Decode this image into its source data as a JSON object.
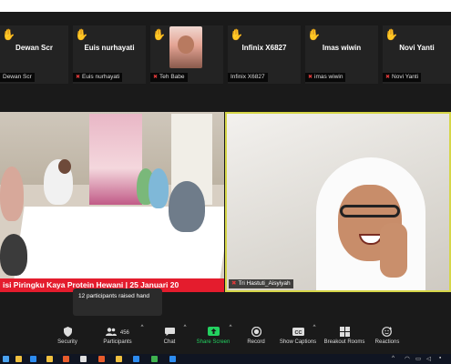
{
  "participants_strip": [
    {
      "name": "Dewan Scr",
      "label": "Dewan Scr",
      "muted": false
    },
    {
      "name": "Euis nurhayati",
      "label": "Euis nurhayati",
      "muted": true
    },
    {
      "name": "",
      "label": "Teh Babe",
      "muted": true,
      "has_video": true
    },
    {
      "name": "Infinix X6827",
      "label": "Infinix X6827",
      "muted": false
    },
    {
      "name": "Imas wiwin",
      "label": "imas wiwin",
      "muted": true
    },
    {
      "name": "Novi Yanti",
      "label": "Novi Yanti",
      "muted": true
    }
  ],
  "main_left": {
    "caption": "isi Piringku Kaya Protein Hewani | 25 Januari 20"
  },
  "main_right": {
    "name": "Tri Hastuti_Aisyiyah"
  },
  "tooltip": {
    "text": "12 participants raised hand"
  },
  "toolbar": {
    "security": "Security",
    "participants": "Participants",
    "participants_count": "456",
    "chat": "Chat",
    "share_screen": "Share Screen",
    "record": "Record",
    "show_captions": "Show Captions",
    "breakout_rooms": "Breakout Rooms",
    "reactions": "Reactions"
  },
  "colors": {
    "raised_hand": "#f5c518",
    "share_green": "#23d160",
    "caption_red": "#e41c2d",
    "active_speaker_border": "#d6d648"
  },
  "icons": {
    "hand": "raised-hand-icon",
    "mic_muted": "muted-mic-icon"
  }
}
